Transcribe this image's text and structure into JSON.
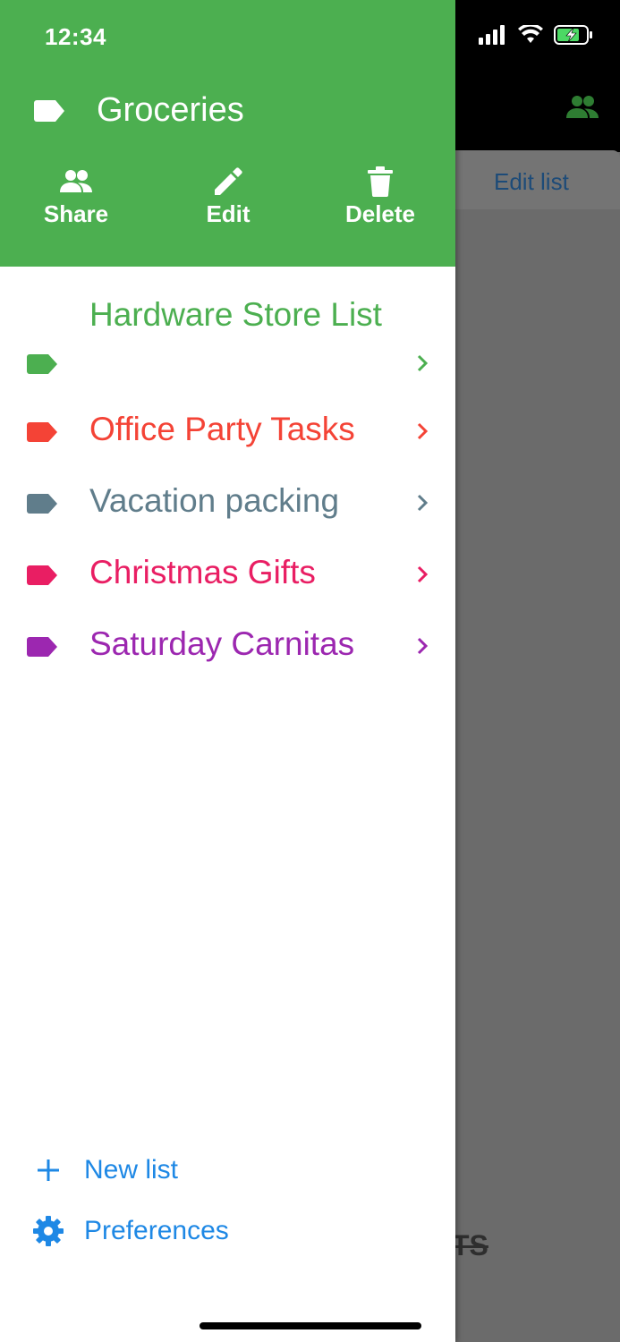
{
  "status_bar": {
    "time": "12:34"
  },
  "drawer": {
    "title": "Groceries",
    "accent": "#4caf50",
    "actions": [
      {
        "label": "Share",
        "icon": "people-icon"
      },
      {
        "label": "Edit",
        "icon": "pencil-icon"
      },
      {
        "label": "Delete",
        "icon": "trash-icon"
      }
    ],
    "lists": [
      {
        "name": "Hardware Store List",
        "color": "#4caf50"
      },
      {
        "name": "Office Party Tasks",
        "color": "#f44336"
      },
      {
        "name": "Vacation packing",
        "color": "#607d8b"
      },
      {
        "name": "Christmas Gifts",
        "color": "#e91e63"
      },
      {
        "name": "Saturday Carnitas",
        "color": "#9c27b0"
      }
    ],
    "footer": {
      "new_list": "New list",
      "preferences": "Preferences",
      "link_color": "#1e88e5"
    }
  },
  "background": {
    "edit_list_label": "Edit list",
    "partial_text": "TS"
  }
}
